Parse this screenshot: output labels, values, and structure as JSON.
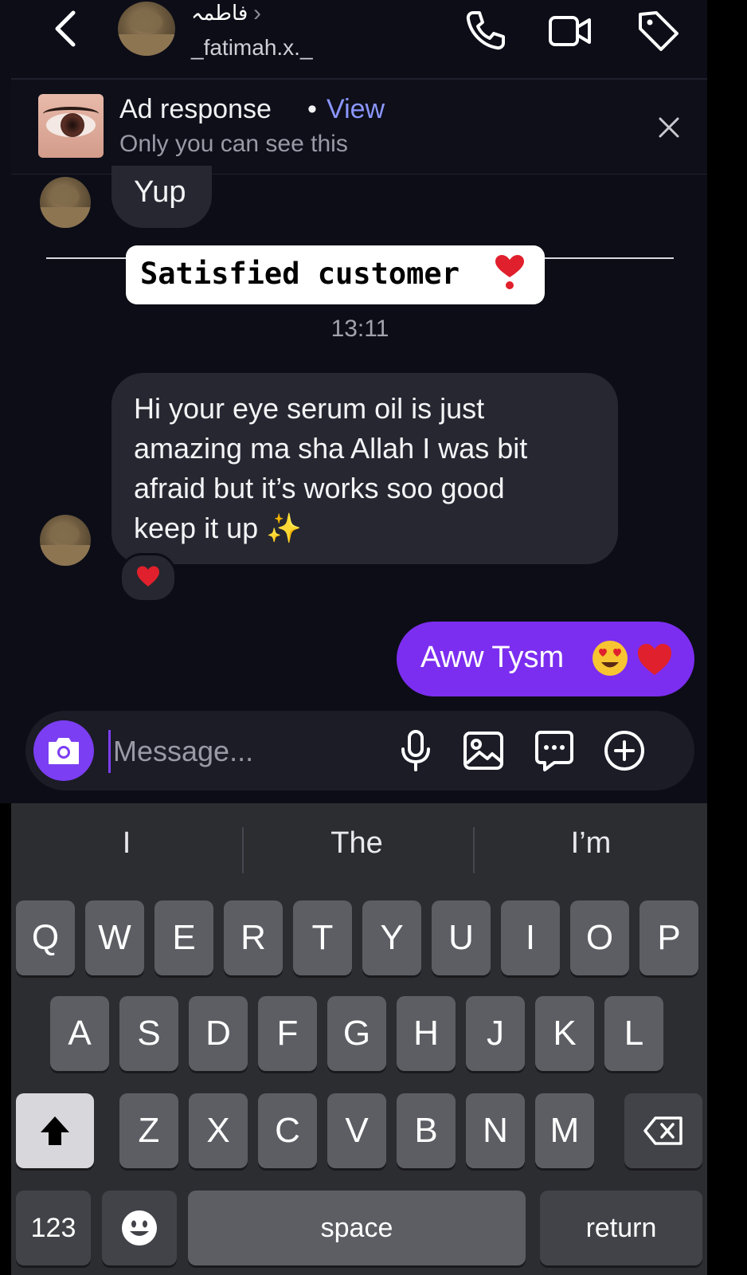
{
  "header": {
    "name": "فاطمہ",
    "username": "_fatimah.x._",
    "icons": [
      "back-chevron-icon",
      "phone-icon",
      "video-camera-icon",
      "tag-icon"
    ]
  },
  "ad_banner": {
    "title": "Ad response",
    "separator": "•",
    "view_label": "View",
    "subtitle": "Only you can see this"
  },
  "messages": {
    "yup": "Yup",
    "sticker_text": "Satisfied customer",
    "timestamp": "13:11",
    "incoming_lines": [
      "Hi your eye serum oil is just",
      "amazing ma sha Allah I was bit",
      "afraid but it’s works soo good",
      "keep it up ✨"
    ],
    "reaction": "heart",
    "outgoing": "Aww Tysm"
  },
  "composer": {
    "placeholder": "Message...",
    "icons": [
      "camera-icon",
      "microphone-icon",
      "image-icon",
      "sticker-icon",
      "plus-icon"
    ]
  },
  "keyboard": {
    "suggestions": [
      "I",
      "The",
      "I’m"
    ],
    "row1": [
      "Q",
      "W",
      "E",
      "R",
      "T",
      "Y",
      "U",
      "I",
      "O",
      "P"
    ],
    "row2": [
      "A",
      "S",
      "D",
      "F",
      "G",
      "H",
      "J",
      "K",
      "L"
    ],
    "row3": [
      "Z",
      "X",
      "C",
      "V",
      "B",
      "N",
      "M"
    ],
    "numbers_label": "123",
    "space_label": "space",
    "return_label": "return"
  },
  "colors": {
    "accent": "#7c2ef0",
    "link": "#8b96ff",
    "background": "#0c0d17",
    "bubble_in": "#262730"
  }
}
